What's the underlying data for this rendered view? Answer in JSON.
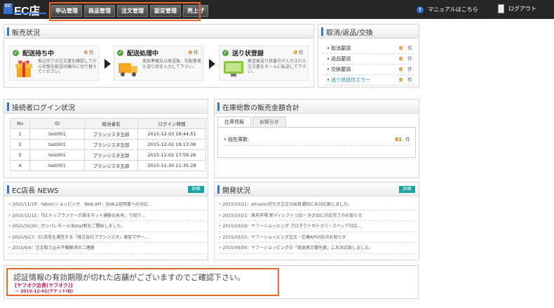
{
  "header": {
    "logo_mark": "EC",
    "logo_text": "EC店長",
    "nav": [
      "申込管理",
      "商品管理",
      "注文管理",
      "設定管理",
      "売上げ"
    ],
    "manual_label": "マニュアルはこちら",
    "logout_label": "ログアウト"
  },
  "sales_status": {
    "title": "販売状況",
    "cards": [
      {
        "title": "配送待ち中",
        "count": "0",
        "unit": "件",
        "desc": "取込完了の注文書を確認してから状態を配送待機中に切り替えてください。"
      },
      {
        "title": "配送処理中",
        "count": "0",
        "unit": "件",
        "desc": "商品準備又は発送後、宅配業者と送り状を入力して下さい。"
      },
      {
        "title": "送り状登録",
        "count": "0",
        "unit": "件",
        "desc": "発送後送り状番号が入力された注文書をモールに転送して下さい。"
      }
    ]
  },
  "cancel_panel": {
    "title": "取消/返品/交換",
    "rows": [
      {
        "label": "取消要請",
        "count": "0",
        "unit": "件"
      },
      {
        "label": "返品要請",
        "count": "0",
        "unit": "件"
      },
      {
        "label": "交換要請",
        "count": "0",
        "unit": "件"
      },
      {
        "label": "送り状送信エラー",
        "count": "0",
        "unit": "件"
      }
    ]
  },
  "login_status": {
    "title": "接続者ログイン状況",
    "columns": [
      "No",
      "ID",
      "担当者名",
      "ログイン時間"
    ],
    "rows": [
      [
        "1",
        "test001",
        "ブランジスタ五郎",
        "2015-12-03 18:44:51"
      ],
      [
        "2",
        "test001",
        "ブランジスタ五郎",
        "2015-12-02 19:13:08"
      ],
      [
        "3",
        "test001",
        "ブランジスタ五郎",
        "2015-12-02 17:59:26"
      ],
      [
        "4",
        "test001",
        "ブランジスタ五郎",
        "2015-11-30 11:35:28"
      ]
    ]
  },
  "inventory": {
    "title": "在庫総数の販売金額合計",
    "tabs": [
      "在庫情報",
      "お知らせ"
    ],
    "stock_label": "総在庫数:",
    "stock_count": "81",
    "stock_unit": "件"
  },
  "news": {
    "title": "EC店長 NEWS",
    "more_label": "詳細",
    "items": [
      "2015/11/19：Yahoo!ショッピング　Web API：SHA-2証明書への対応…",
      "2015/11/12：「ECトップランナーが語るネット通販の未来」で紹介…",
      "2015/10/26：ポンパレモール(Beta)新をご開始しました。",
      "2015/9/17：EC店長を運営する「株式会社ブランジスタ」東証マザー…",
      "2015/9/4：注文取り込み不備解消のご連絡"
    ]
  },
  "dev": {
    "title": "開発状況",
    "more_label": "詳細",
    "items": [
      "2015/10/21：amazon代引き注文の出荷通知にお対応致しました。",
      "2015/10/21：楽天市場 新ディレクトリID・タグIDに対応完了のお知らせ",
      "2015/10/19：ヤフーショッピング プロダクトカテゴリ・スペック対応…",
      "2015/10/15：ヤフーショッピング注文・在庫API対応のお知らせ",
      "2015/09/09：ヤフーショッピングの「商品表示優先度」にお対応致しました。"
    ]
  },
  "notice": {
    "message": "認証情報の有効期限が切れた店舗がございますのでご確認下さい。",
    "shop": "[ヤフオク店長(ヤフオク)]",
    "date": "－ 2015-12-01(チケットID)"
  },
  "colors": {
    "accent": "#e8672a",
    "header": "#262626",
    "count": "#e06a00",
    "link": "#1a8fa6"
  }
}
